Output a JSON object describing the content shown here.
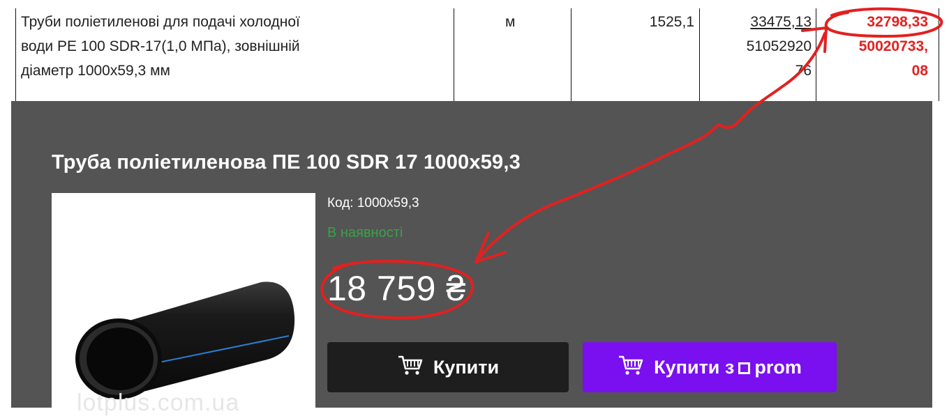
{
  "table_row": {
    "description_lines": [
      "Труби поліетиленові для подачі холодної",
      "води PE 100 SDR-17(1,0 МПа), зовнішній",
      "діаметр 1000х59,3 мм"
    ],
    "unit": "м",
    "quantity": "1525,1",
    "price_lines": [
      "33475,13",
      "51052920",
      "76"
    ],
    "new_price_lines": [
      "32798,33",
      "50020733,",
      "08"
    ]
  },
  "product": {
    "title": "Труба поліетиленова ПЕ 100 SDR 17 1000x59,3",
    "code": "Код: 1000x59,3",
    "availability": "В наявності",
    "price": "18 759 ₴",
    "watermark": "lotplus.com.ua",
    "buy_label": "Купити",
    "buy_prom_label": "Купити з",
    "prom_brand": "prom"
  },
  "icons": [
    "cart-icon",
    "prom-logo-icon"
  ],
  "colors": {
    "card_bg": "#545454",
    "availability": "#3ca04a",
    "buy_bg": "#1e1e1e",
    "prom_bg": "#7a0ff0",
    "annotation": "#e32020"
  }
}
